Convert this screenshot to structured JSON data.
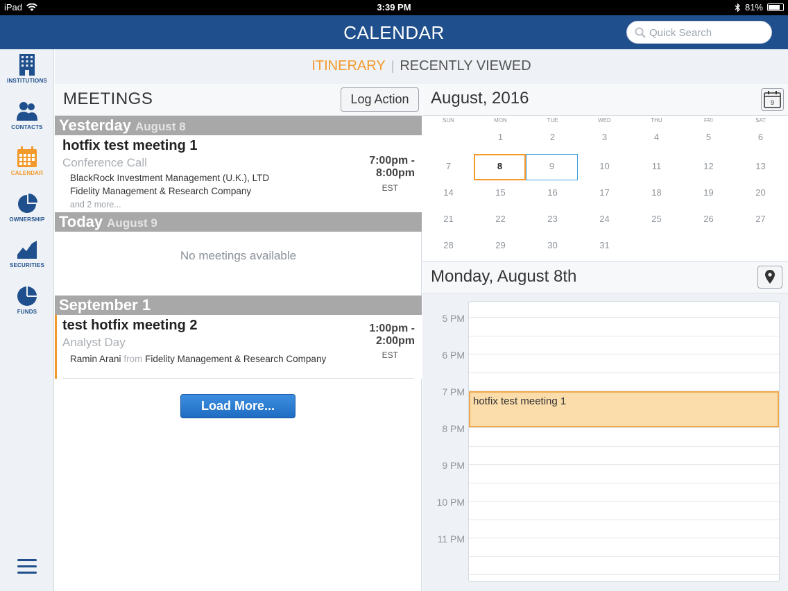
{
  "status_bar": {
    "device": "iPad",
    "time": "3:39 PM",
    "battery": "81%",
    "battery_level": 0.81
  },
  "header": {
    "title": "CALENDAR",
    "search_placeholder": "Quick Search"
  },
  "sidebar": {
    "items": [
      {
        "label": "INSTITUTIONS",
        "icon": "building-icon",
        "active": false
      },
      {
        "label": "CONTACTS",
        "icon": "people-icon",
        "active": false
      },
      {
        "label": "CALENDAR",
        "icon": "calendar-icon",
        "active": true
      },
      {
        "label": "OWNERSHIP",
        "icon": "pie-chart-icon",
        "active": false
      },
      {
        "label": "SECURITIES",
        "icon": "area-chart-icon",
        "active": false
      },
      {
        "label": "FUNDS",
        "icon": "pie-chart-icon",
        "active": false
      }
    ]
  },
  "tabs": {
    "itinerary": "ITINERARY",
    "separator": "|",
    "recently_viewed": "RECENTLY VIEWED"
  },
  "meetings": {
    "title": "MEETINGS",
    "log_action": "Log Action",
    "groups": [
      {
        "day": "Yesterday",
        "date": "August 8",
        "meetings": [
          {
            "name": "hotfix test meeting 1",
            "type": "Conference Call",
            "orgs": [
              "BlackRock Investment Management (U.K.), LTD",
              "Fidelity Management & Research Company"
            ],
            "more": "and 2 more...",
            "time_start": "7:00pm -",
            "time_end": "8:00pm",
            "tz": "EST"
          }
        ]
      },
      {
        "day": "Today",
        "date": "August 9",
        "empty_text": "No meetings available"
      },
      {
        "day": "September 1",
        "date": "",
        "meetings": [
          {
            "name": "test hotfix meeting 2",
            "type": "Analyst Day",
            "contact": "Ramin Arani",
            "from": "from",
            "org": "Fidelity Management & Research Company",
            "time_start": "1:00pm -",
            "time_end": "2:00pm",
            "tz": "EST"
          }
        ]
      }
    ],
    "load_more": "Load More..."
  },
  "calendar": {
    "month_title": "August, 2016",
    "icon_day": "9",
    "weekdays": [
      "SUN",
      "MON",
      "TUE",
      "WED",
      "THU",
      "FRI",
      "SAT"
    ],
    "weeks": [
      [
        "",
        "1",
        "2",
        "3",
        "4",
        "5",
        "6"
      ],
      [
        "7",
        "8",
        "9",
        "10",
        "11",
        "12",
        "13"
      ],
      [
        "14",
        "15",
        "16",
        "17",
        "18",
        "19",
        "20"
      ],
      [
        "21",
        "22",
        "23",
        "24",
        "25",
        "26",
        "27"
      ],
      [
        "28",
        "29",
        "30",
        "31",
        "",
        "",
        ""
      ]
    ],
    "selected_day": "8",
    "today": "9"
  },
  "day_view": {
    "title": "Monday, August 8th",
    "hours": [
      "5 PM",
      "6 PM",
      "7 PM",
      "8 PM",
      "9 PM",
      "10 PM",
      "11 PM"
    ],
    "event": {
      "title": "hotfix test meeting 1"
    }
  }
}
